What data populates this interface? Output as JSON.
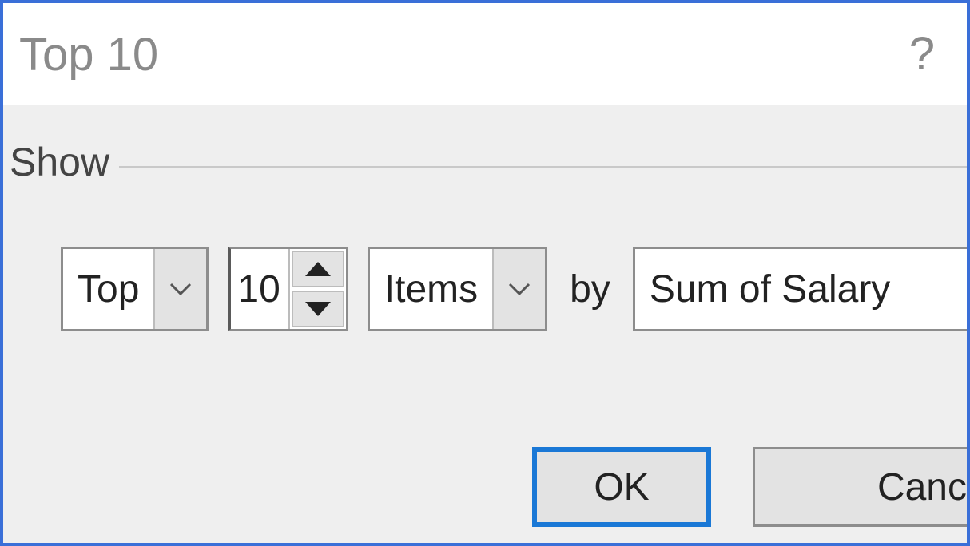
{
  "dialog": {
    "title": "Top 10",
    "help_icon": "?",
    "section_label": "Show",
    "direction": "Top",
    "count": "10",
    "unit": "Items",
    "by_label": "by",
    "field": "Sum of Salary",
    "ok_label": "OK",
    "cancel_label": "Canc"
  }
}
